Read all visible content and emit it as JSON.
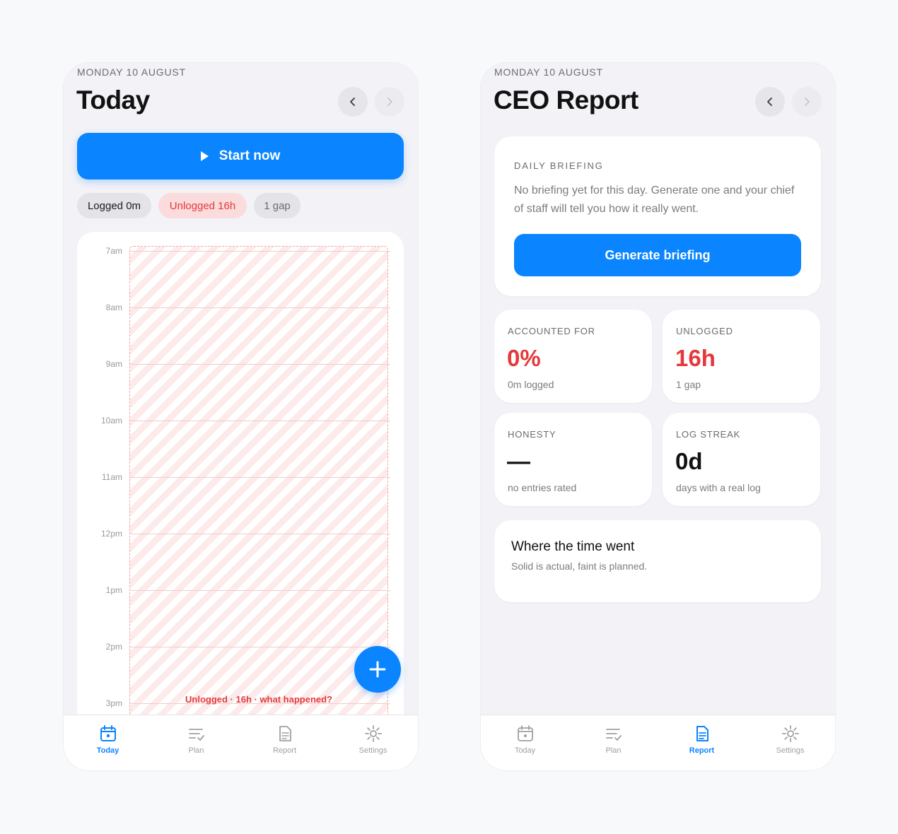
{
  "today_screen": {
    "date": "MONDAY 10 AUGUST",
    "title": "Today",
    "start_label": "Start now",
    "pills": {
      "logged": "Logged 0m",
      "unlogged": "Unlogged 16h",
      "gap": "1 gap"
    },
    "timeline": {
      "hours": [
        "7am",
        "8am",
        "9am",
        "10am",
        "11am",
        "12pm",
        "1pm",
        "2pm",
        "3pm"
      ],
      "unlogged_caption": "Unlogged · 16h · what happened?"
    },
    "icons": {
      "prev": "chevron-left-icon",
      "next": "chevron-right-icon",
      "start": "play-icon",
      "fab": "plus-icon"
    }
  },
  "report_screen": {
    "date": "MONDAY 10 AUGUST",
    "title": "CEO Report",
    "briefing": {
      "heading": "DAILY BRIEFING",
      "text": "No briefing yet for this day. Generate one and your chief of staff will tell you how it really went.",
      "button": "Generate briefing"
    },
    "stats": {
      "accounted": {
        "label": "ACCOUNTED FOR",
        "value": "0%",
        "sub": "0m logged"
      },
      "unlogged": {
        "label": "UNLOGGED",
        "value": "16h",
        "sub": "1 gap"
      },
      "honesty": {
        "label": "HONESTY",
        "value": "—",
        "sub": "no entries rated"
      },
      "streak": {
        "label": "LOG STREAK",
        "value": "0d",
        "sub": "days with a real log"
      }
    },
    "where": {
      "title": "Where the time went",
      "subtitle": "Solid is actual, faint is planned."
    }
  },
  "tabs": {
    "today": "Today",
    "plan": "Plan",
    "report": "Report",
    "settings": "Settings"
  },
  "colors": {
    "accent": "#0a84ff",
    "danger": "#e5383b",
    "background": "#f2f2f7",
    "tab_inactive": "#a0a0a6"
  }
}
